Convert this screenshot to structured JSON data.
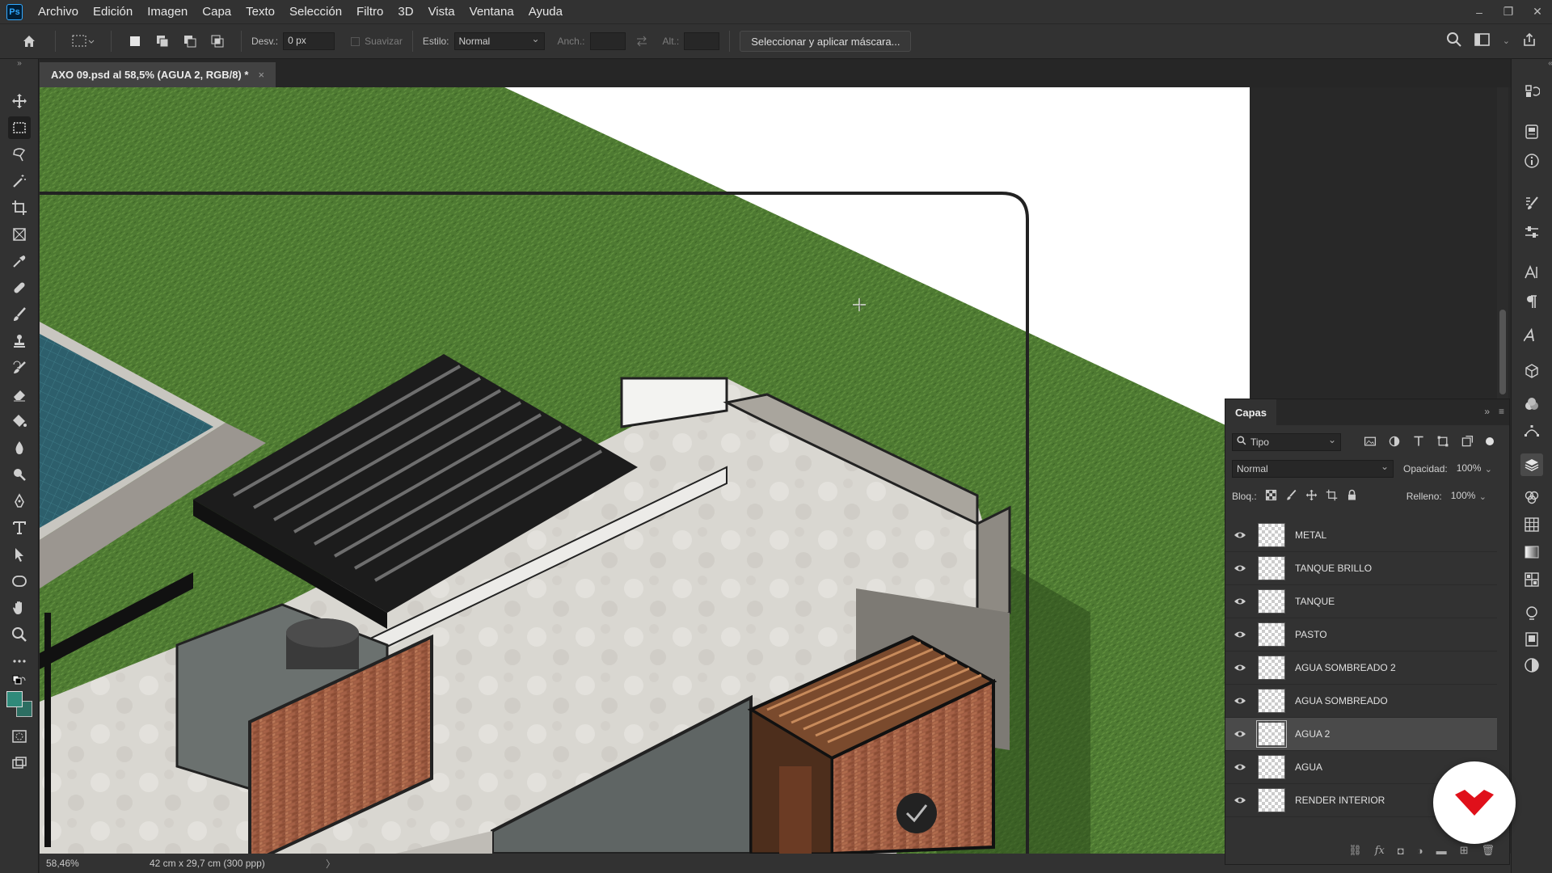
{
  "app": {
    "logo_text": "Ps"
  },
  "menu": [
    "Archivo",
    "Edición",
    "Imagen",
    "Capa",
    "Texto",
    "Selección",
    "Filtro",
    "3D",
    "Vista",
    "Ventana",
    "Ayuda"
  ],
  "options": {
    "feather_label": "Desv.:",
    "feather_value": "0 px",
    "antialias_label": "Suavizar",
    "style_label": "Estilo:",
    "style_value": "Normal",
    "width_label": "Anch.:",
    "height_label": "Alt.:",
    "mask_button": "Seleccionar y aplicar máscara..."
  },
  "document": {
    "tab_title": "AXO 09.psd al 58,5% (AGUA 2, RGB/8) *",
    "close": "×"
  },
  "status": {
    "zoom": "58,46%",
    "doc_info": "42 cm x 29,7 cm (300 ppp)",
    "arrow": "〉"
  },
  "layers_panel": {
    "title": "Capas",
    "filter_label": "Tipo",
    "blend_mode": "Normal",
    "opacity_label": "Opacidad:",
    "opacity_value": "100%",
    "lock_label": "Bloq.:",
    "fill_label": "Relleno:",
    "fill_value": "100%",
    "layers": [
      {
        "name": "METAL",
        "visible": true,
        "selected": false
      },
      {
        "name": "TANQUE BRILLO",
        "visible": true,
        "selected": false
      },
      {
        "name": "TANQUE",
        "visible": true,
        "selected": false
      },
      {
        "name": "PASTO",
        "visible": true,
        "selected": false
      },
      {
        "name": "AGUA SOMBREADO 2",
        "visible": true,
        "selected": false
      },
      {
        "name": "AGUA SOMBREADO",
        "visible": true,
        "selected": false
      },
      {
        "name": "AGUA 2",
        "visible": true,
        "selected": true
      },
      {
        "name": "AGUA",
        "visible": true,
        "selected": false
      },
      {
        "name": "RENDER INTERIOR",
        "visible": true,
        "selected": false
      }
    ]
  },
  "colors": {
    "accent": "#31a8ff",
    "foreground_swatch": "#2f8a7a",
    "background_swatch": "#2d6e62",
    "grass": "#4f7a32",
    "badge_red": "#e0101a"
  }
}
